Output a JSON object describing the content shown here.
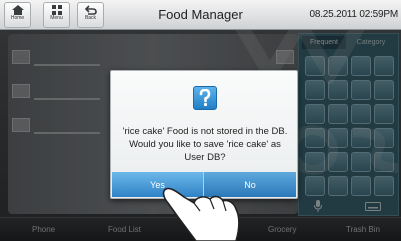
{
  "topbar": {
    "home_label": "Home",
    "menu_label": "Menu",
    "back_label": "Back",
    "title": "Food Manager",
    "datetime": "08.25.2011 02:59PM"
  },
  "side_panel": {
    "tab_frequent": "Frequent",
    "tab_category": "Category"
  },
  "bottom_nav": [
    "Phone",
    "Food List",
    "",
    "Grocery",
    "Trash Bin"
  ],
  "dialog": {
    "icon": "question-icon",
    "message_line1": "'rice cake' Food is not stored in the DB.",
    "message_line2": "Would you like to save 'rice cake' as",
    "message_line3": "User DB?",
    "yes_label": "Yes",
    "no_label": "No"
  },
  "colors": {
    "dialog_button": "#3b8dd0",
    "question_icon": "#2f8fd6",
    "side_panel": "#3f6c7a"
  }
}
